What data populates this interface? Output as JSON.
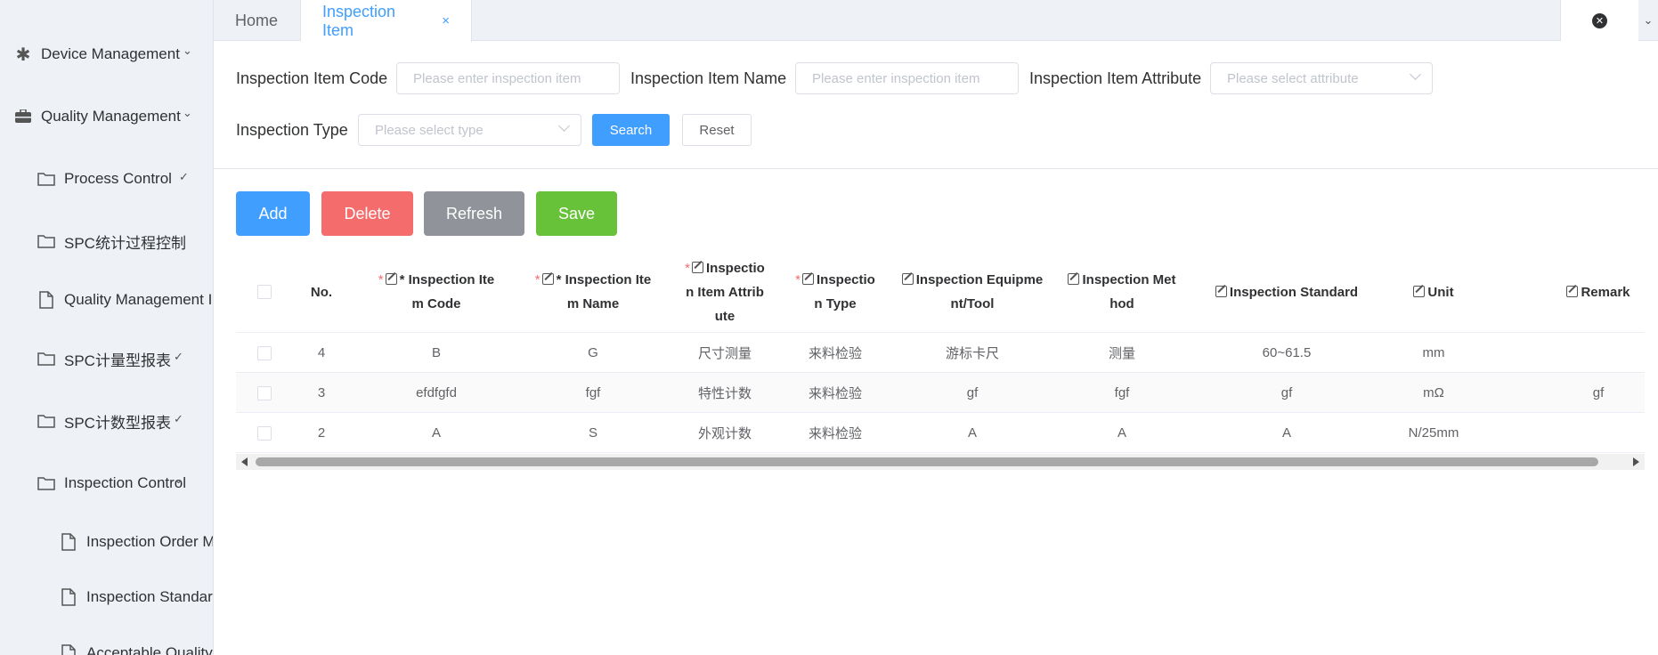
{
  "sidebar": {
    "items": [
      {
        "label": "Device Management",
        "icon": "asterisk-icon"
      },
      {
        "label": "Quality Management",
        "icon": "briefcase-icon"
      },
      {
        "label": "Process Control",
        "icon": "folder-icon"
      },
      {
        "label": "SPC统计过程控制",
        "icon": "folder-icon"
      },
      {
        "label": "Quality Management I",
        "icon": "document-icon"
      },
      {
        "label": "SPC计量型报表",
        "icon": "folder-icon"
      },
      {
        "label": "SPC计数型报表",
        "icon": "folder-icon"
      },
      {
        "label": "Inspection Control",
        "icon": "folder-icon"
      },
      {
        "label": "Inspection Order M",
        "icon": "document-icon"
      },
      {
        "label": "Inspection Standar",
        "icon": "document-icon"
      },
      {
        "label": "Acceptable Quality",
        "icon": "document-icon"
      }
    ]
  },
  "tabs": [
    {
      "label": "Home"
    },
    {
      "label": "Inspection Item",
      "close": "×"
    }
  ],
  "filters": {
    "code_label": "Inspection Item Code",
    "code_placeholder": "Please enter inspection item",
    "name_label": "Inspection Item Name",
    "name_placeholder": "Please enter inspection item",
    "attr_label": "Inspection Item Attribute",
    "attr_placeholder": "Please select attribute",
    "type_label": "Inspection Type",
    "type_placeholder": "Please select type",
    "search_label": "Search",
    "reset_label": "Reset"
  },
  "actions": {
    "add": "Add",
    "delete": "Delete",
    "refresh": "Refresh",
    "save": "Save",
    "colors": {
      "add": "#409eff",
      "delete": "#f56c6c",
      "refresh": "#909399",
      "save": "#67c23a"
    }
  },
  "table": {
    "headers": {
      "no": "No.",
      "code": "* Inspection Ite\nm Code",
      "name": "* Inspection Ite\nm Name",
      "attr": "Inspectio\nn Item Attrib\nute",
      "type": "Inspectio\nn Type",
      "equip": "Inspection Equipme\nnt/Tool",
      "method": "Inspection Met\nhod",
      "standard": "Inspection Standard",
      "unit": "Unit",
      "remark": "Remark"
    },
    "rows": [
      {
        "no": "4",
        "code": "B",
        "name": "G",
        "attr": "尺寸测量",
        "type": "来料检验",
        "equip": "游标卡尺",
        "method": "测量",
        "standard": "60~61.5",
        "unit": "mm",
        "remark": ""
      },
      {
        "no": "3",
        "code": "efdfgfd",
        "name": "fgf",
        "attr": "特性计数",
        "type": "来料检验",
        "equip": "gf",
        "method": "fgf",
        "standard": "gf",
        "unit": "mΩ",
        "remark": "gf"
      },
      {
        "no": "2",
        "code": "A",
        "name": "S",
        "attr": "外观计数",
        "type": "来料检验",
        "equip": "A",
        "method": "A",
        "standard": "A",
        "unit": "N/25mm",
        "remark": ""
      }
    ]
  }
}
